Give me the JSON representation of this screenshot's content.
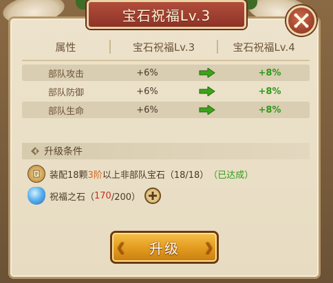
{
  "title": "宝石祝福Lv.3",
  "table": {
    "headers": [
      "属性",
      "宝石祝福Lv.3",
      "宝石祝福Lv.4"
    ],
    "rows": [
      {
        "attr": "部队攻击",
        "current": "+6%",
        "next": "+8%"
      },
      {
        "attr": "部队防御",
        "current": "+6%",
        "next": "+8%"
      },
      {
        "attr": "部队生命",
        "current": "+6%",
        "next": "+8%"
      }
    ]
  },
  "conditions": {
    "title": "升级条件",
    "req1": {
      "prefix": "装配18颗",
      "tier": "3阶",
      "suffix": "以上非部队宝石（18/18）",
      "status": "（已达成）"
    },
    "req2": {
      "name": "祝福之石（",
      "have": "170",
      "need": "/200）"
    }
  },
  "upgrade_label": "升级",
  "colors": {
    "accent_green": "#2f9a19",
    "accent_orange": "#d0661b",
    "title_red": "#8e3327",
    "button_gold": "#e19a1e"
  },
  "icons": {
    "close": "close-icon",
    "arrow": "arrow-right-icon",
    "conditions": "diamond-icon",
    "scroll": "scroll-icon",
    "gem": "gem-icon",
    "add": "plus-icon"
  }
}
